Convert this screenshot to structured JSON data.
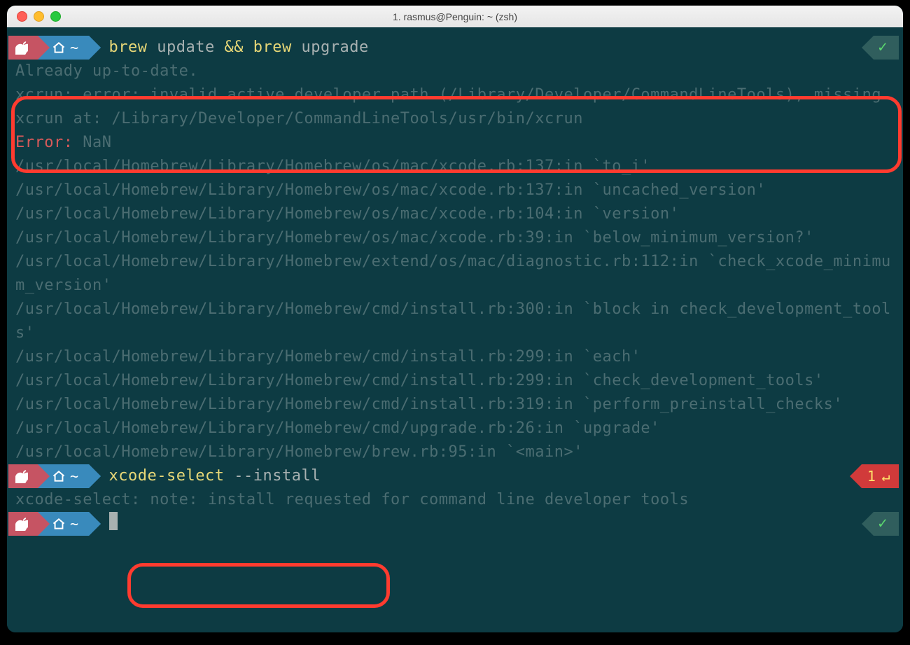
{
  "window": {
    "title": "1. rasmus@Penguin: ~ (zsh)"
  },
  "prompt": {
    "seg2_tilde": "~",
    "status_ok_glyph": "✓",
    "status_err_code": "1",
    "status_err_glyph": "↵"
  },
  "cmd1": {
    "p1": "brew",
    "p2": " update ",
    "p3": "&&",
    "p4": " brew",
    "p5": " upgrade"
  },
  "lines": {
    "already": "Already up-to-date.",
    "xcrun": "xcrun: error: invalid active developer path (/Library/Developer/CommandLineTools), missing xcrun at: /Library/Developer/CommandLineTools/usr/bin/xcrun",
    "err_label": "Error:",
    "err_value": " NaN",
    "t1": "/usr/local/Homebrew/Library/Homebrew/os/mac/xcode.rb:137:in `to_i'",
    "t2": "/usr/local/Homebrew/Library/Homebrew/os/mac/xcode.rb:137:in `uncached_version'",
    "t3": "/usr/local/Homebrew/Library/Homebrew/os/mac/xcode.rb:104:in `version'",
    "t4": "/usr/local/Homebrew/Library/Homebrew/os/mac/xcode.rb:39:in `below_minimum_version?'",
    "t5": "/usr/local/Homebrew/Library/Homebrew/extend/os/mac/diagnostic.rb:112:in `check_xcode_minimum_version'",
    "t6": "/usr/local/Homebrew/Library/Homebrew/cmd/install.rb:300:in `block in check_development_tools'",
    "t7": "/usr/local/Homebrew/Library/Homebrew/cmd/install.rb:299:in `each'",
    "t8": "/usr/local/Homebrew/Library/Homebrew/cmd/install.rb:299:in `check_development_tools'",
    "t9": "/usr/local/Homebrew/Library/Homebrew/cmd/install.rb:319:in `perform_preinstall_checks'",
    "t10": "/usr/local/Homebrew/Library/Homebrew/cmd/upgrade.rb:26:in `upgrade'",
    "t11": "/usr/local/Homebrew/Library/Homebrew/brew.rb:95:in `<main>'"
  },
  "cmd2": {
    "p1": "xcode-select",
    "p2": " --install"
  },
  "note": "xcode-select: note: install requested for command line developer tools"
}
